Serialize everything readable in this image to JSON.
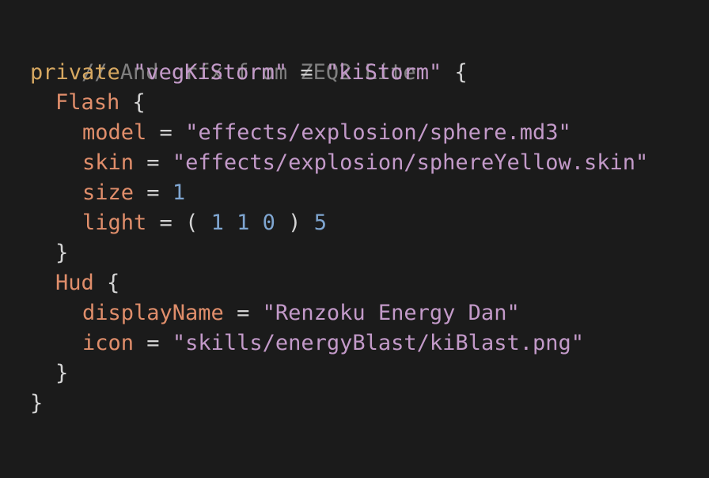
{
  "colors": {
    "background": "#1b1b1b",
    "comment": "#7f7f7f",
    "keyword": "#d7a861",
    "string": "#c39ac9",
    "key": "#e08e6b",
    "number": "#7fa6d1",
    "punctuation": "#d4d4d4"
  },
  "code": {
    "comment": "// And grfx from ZEQ2 Lite",
    "decl": {
      "keyword": "private",
      "name": "\"vegKiStorm\"",
      "eq": " = ",
      "value": "\"kiStorm\"",
      "open": " {"
    },
    "flash": {
      "name": "Flash",
      "open": " {",
      "model_key": "model",
      "model_value": "\"effects/explosion/sphere.md3\"",
      "skin_key": "skin",
      "skin_value": "\"effects/explosion/sphereYellow.skin\"",
      "size_key": "size",
      "size_value": "1",
      "light_key": "light",
      "light_open": "( ",
      "light_r": "1",
      "light_g": "1",
      "light_b": "0",
      "light_close": " ) ",
      "light_radius": "5",
      "close": "}"
    },
    "hud": {
      "name": "Hud",
      "open": " {",
      "display_key": "displayName",
      "display_value": "\"Renzoku Energy Dan\"",
      "icon_key": "icon",
      "icon_value": "\"skills/energyBlast/kiBlast.png\"",
      "close": "}"
    },
    "eq": " = ",
    "space": " ",
    "close": "}"
  }
}
